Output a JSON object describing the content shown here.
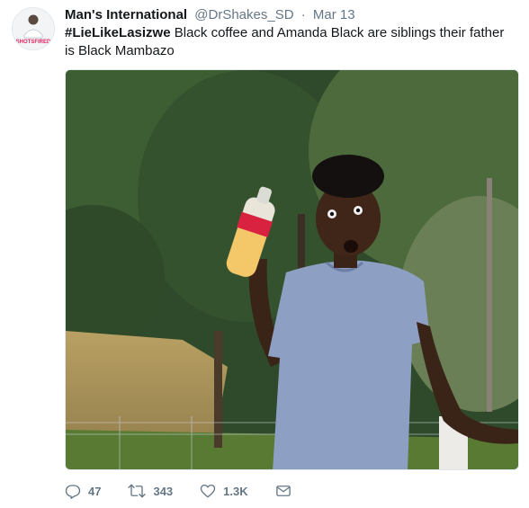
{
  "tweet": {
    "author_name": "Man's International",
    "author_handle": "@DrShakes_SD",
    "separator": "·",
    "date": "Mar 13",
    "hashtag": "#LieLikeLasizwe",
    "text": " Black coffee and Amanda Black are siblings their father is Black Mambazo",
    "avatar_caption": "SHOTSFIRED"
  },
  "actions": {
    "reply_count": "47",
    "retweet_count": "343",
    "like_count": "1.3K"
  },
  "icons": {
    "reply": "reply-icon",
    "retweet": "retweet-icon",
    "like": "heart-icon",
    "dm": "envelope-icon"
  },
  "colors": {
    "secondary_text": "#657786",
    "primary_text": "#14171a",
    "caption_red": "#e0245e"
  }
}
